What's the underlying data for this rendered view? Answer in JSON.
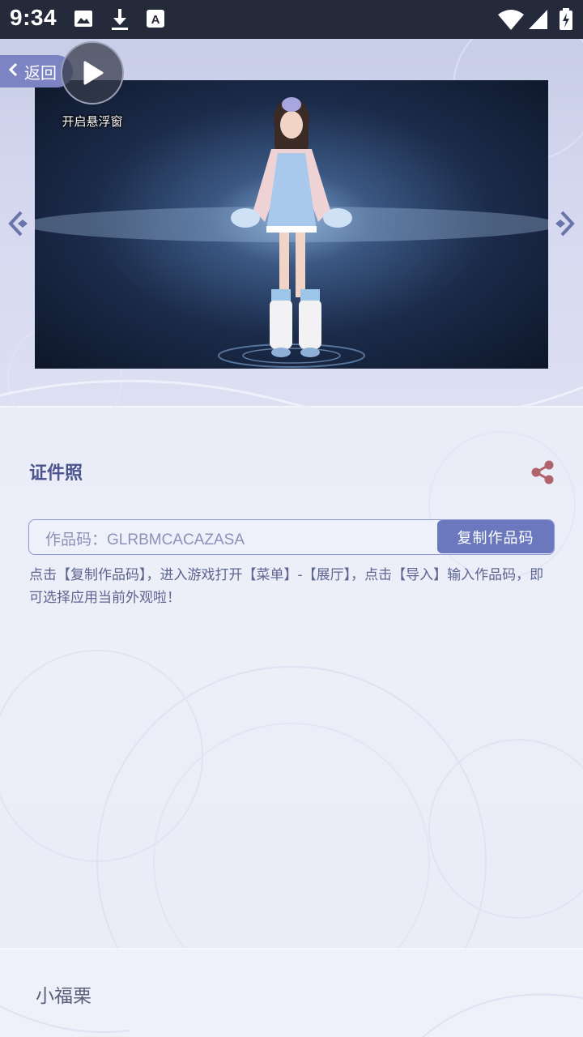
{
  "status_bar": {
    "time": "9:34",
    "icons": [
      "image-icon",
      "download-icon",
      "font-icon",
      "wifi-icon",
      "signal-icon",
      "battery-icon"
    ]
  },
  "header": {
    "back_label": "返回",
    "float_window_label": "开启悬浮窗"
  },
  "work": {
    "title": "证件照",
    "code_prefix": "作品码：",
    "code_value": "GLRBMCACAZASA",
    "copy_label": "复制作品码",
    "hint": "点击【复制作品码】，进入游戏打开【菜单】-【展厅】，点击【导入】输入作品码，即可选择应用当前外观啦！"
  },
  "footer": {
    "author_name": "小福栗"
  },
  "colors": {
    "accent": "#6b78be",
    "title": "#4a5590",
    "share": "#b0636a",
    "status_bar": "#252a3a"
  }
}
